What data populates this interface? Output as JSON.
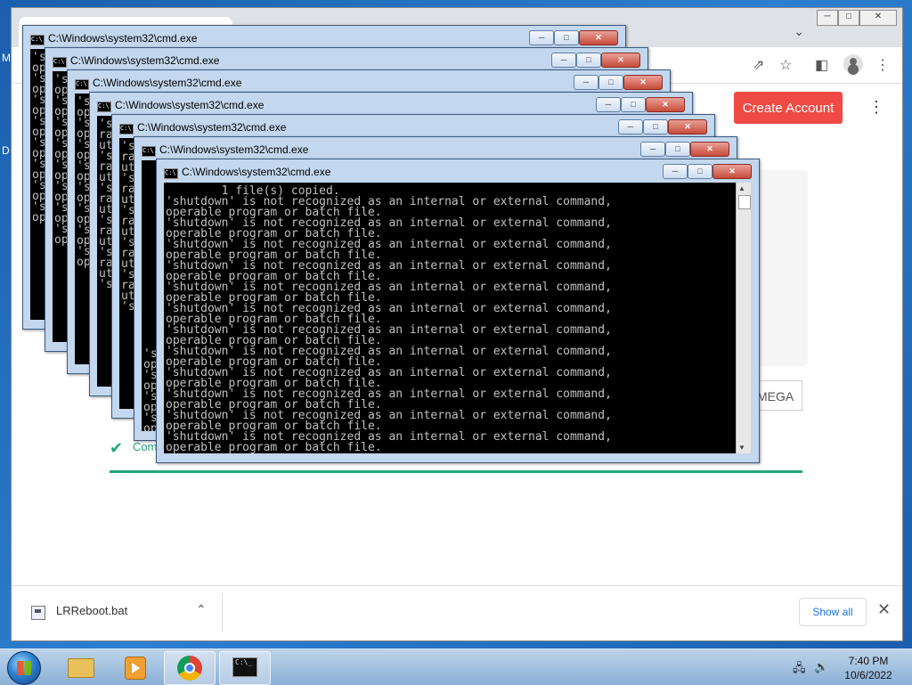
{
  "desktop": {
    "fragment_1": "M",
    "fragment_2": "D"
  },
  "chrome": {
    "window_controls": {
      "minimize": "─",
      "maximize": "□",
      "close": "✕"
    },
    "tab_dropdown": "⌄",
    "toolbar_icons": {
      "share": "⇗",
      "bookmark": "☆",
      "sidepanel": "◧",
      "menu": "⋮"
    }
  },
  "page": {
    "create_account_label": "Create Account",
    "kebab": "⋮",
    "mega_label": "MEGA",
    "complete_text": "Com",
    "check_icon": "✔"
  },
  "download_shelf": {
    "file_name": "LRReboot.bat",
    "chevron": "⌃",
    "show_all_label": "Show all",
    "close": "✕"
  },
  "cmd_windows": {
    "title": "C:\\Windows\\system32\\cmd.exe",
    "icon_text": "C:\\",
    "min": "─",
    "max": "□",
    "close": "✕",
    "back_text": "'s\nop\n's\nop\n's\nop\n's\nop\n's\nop\n's\nop\n's\nop\n's\nop",
    "back_text_2": "'s\nra\nut\n's\nra\nut\n's\nra\nut\n's\nra\nut\n's\nra\nut\n's",
    "front_text": "        1 file(s) copied.\n'shutdown' is not recognized as an internal or external command,\noperable program or batch file.\n'shutdown' is not recognized as an internal or external command,\noperable program or batch file.\n'shutdown' is not recognized as an internal or external command,\noperable program or batch file.\n'shutdown' is not recognized as an internal or external command,\noperable program or batch file.\n'shutdown' is not recognized as an internal or external command,\noperable program or batch file.\n'shutdown' is not recognized as an internal or external command,\noperable program or batch file.\n'shutdown' is not recognized as an internal or external command,\noperable program or batch file.\n'shutdown' is not recognized as an internal or external command,\noperable program or batch file.\n'shutdown' is not recognized as an internal or external command,\noperable program or batch file.\n'shutdown' is not recognized as an internal or external command,\noperable program or batch file.\n'shutdown' is not recognized as an internal or external command,\noperable program or batch file.\n'shutdown' is not recognized as an internal or external command,\noperable program or batch file.",
    "scroll_up": "▲",
    "scroll_down": "▼"
  },
  "taskbar": {
    "cmd_icon_text": "C:\\_",
    "tray_network": "🖧",
    "tray_volume": "🔊",
    "time": "7:40 PM",
    "date": "10/6/2022"
  }
}
